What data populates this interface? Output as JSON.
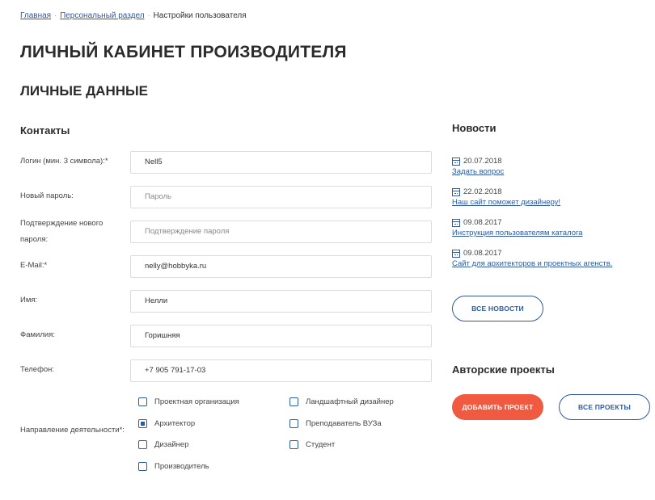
{
  "breadcrumb": {
    "home": "Главная",
    "personal": "Персональный раздел",
    "current": "Настройки пользователя"
  },
  "page_title": "ЛИЧНЫЙ КАБИНЕТ ПРОИЗВОДИТЕЛЯ",
  "section_title": "ЛИЧНЫЕ ДАННЫЕ",
  "contacts": {
    "heading": "Контакты",
    "fields": [
      {
        "label": "Логин (мин. 3 символа):*",
        "value": "Nell5"
      },
      {
        "label": "Новый пароль:",
        "placeholder": "Пароль"
      },
      {
        "label": "Подтверждение нового пароля:",
        "placeholder": "Подтверждение пароля"
      },
      {
        "label": "E-Mail:*",
        "value": "nelly@hobbyka.ru"
      },
      {
        "label": "Имя:",
        "value": "Нелли"
      },
      {
        "label": "Фамилия:",
        "value": "Горишняя"
      },
      {
        "label": "Телефон:",
        "value": "+7 905 791-17-03"
      }
    ],
    "activity_label": "Направление деятельности*:",
    "activities": [
      {
        "label": "Проектная организация",
        "checked": false
      },
      {
        "label": "Ландшафтный дизайнер",
        "checked": false
      },
      {
        "label": "Архитектор",
        "checked": true
      },
      {
        "label": "Преподаватель ВУЗа",
        "checked": false
      },
      {
        "label": "Дизайнер",
        "checked": false
      },
      {
        "label": "Студент",
        "checked": false
      },
      {
        "label": "Производитель",
        "checked": false
      }
    ]
  },
  "news": {
    "heading": "Новости",
    "items": [
      {
        "date": "20.07.2018",
        "title": "Задать вопрос"
      },
      {
        "date": "22.02.2018",
        "title": "Наш сайт поможет дизайнеру!"
      },
      {
        "date": "09.08.2017",
        "title": "Инструкция пользователям каталога"
      },
      {
        "date": "09.08.2017",
        "title": "Сайт для архитекторов и проектных агенств."
      }
    ],
    "all_button": "ВСЕ НОВОСТИ"
  },
  "authors": {
    "heading": "Авторские проекты",
    "add_button": "ДОБАВИТЬ ПРОЕКТ",
    "all_button": "ВСЕ ПРОЕКТЫ"
  },
  "colors": {
    "link": "#2e5a9e",
    "accent": "#f05a40",
    "border": "#dcdcdc"
  }
}
